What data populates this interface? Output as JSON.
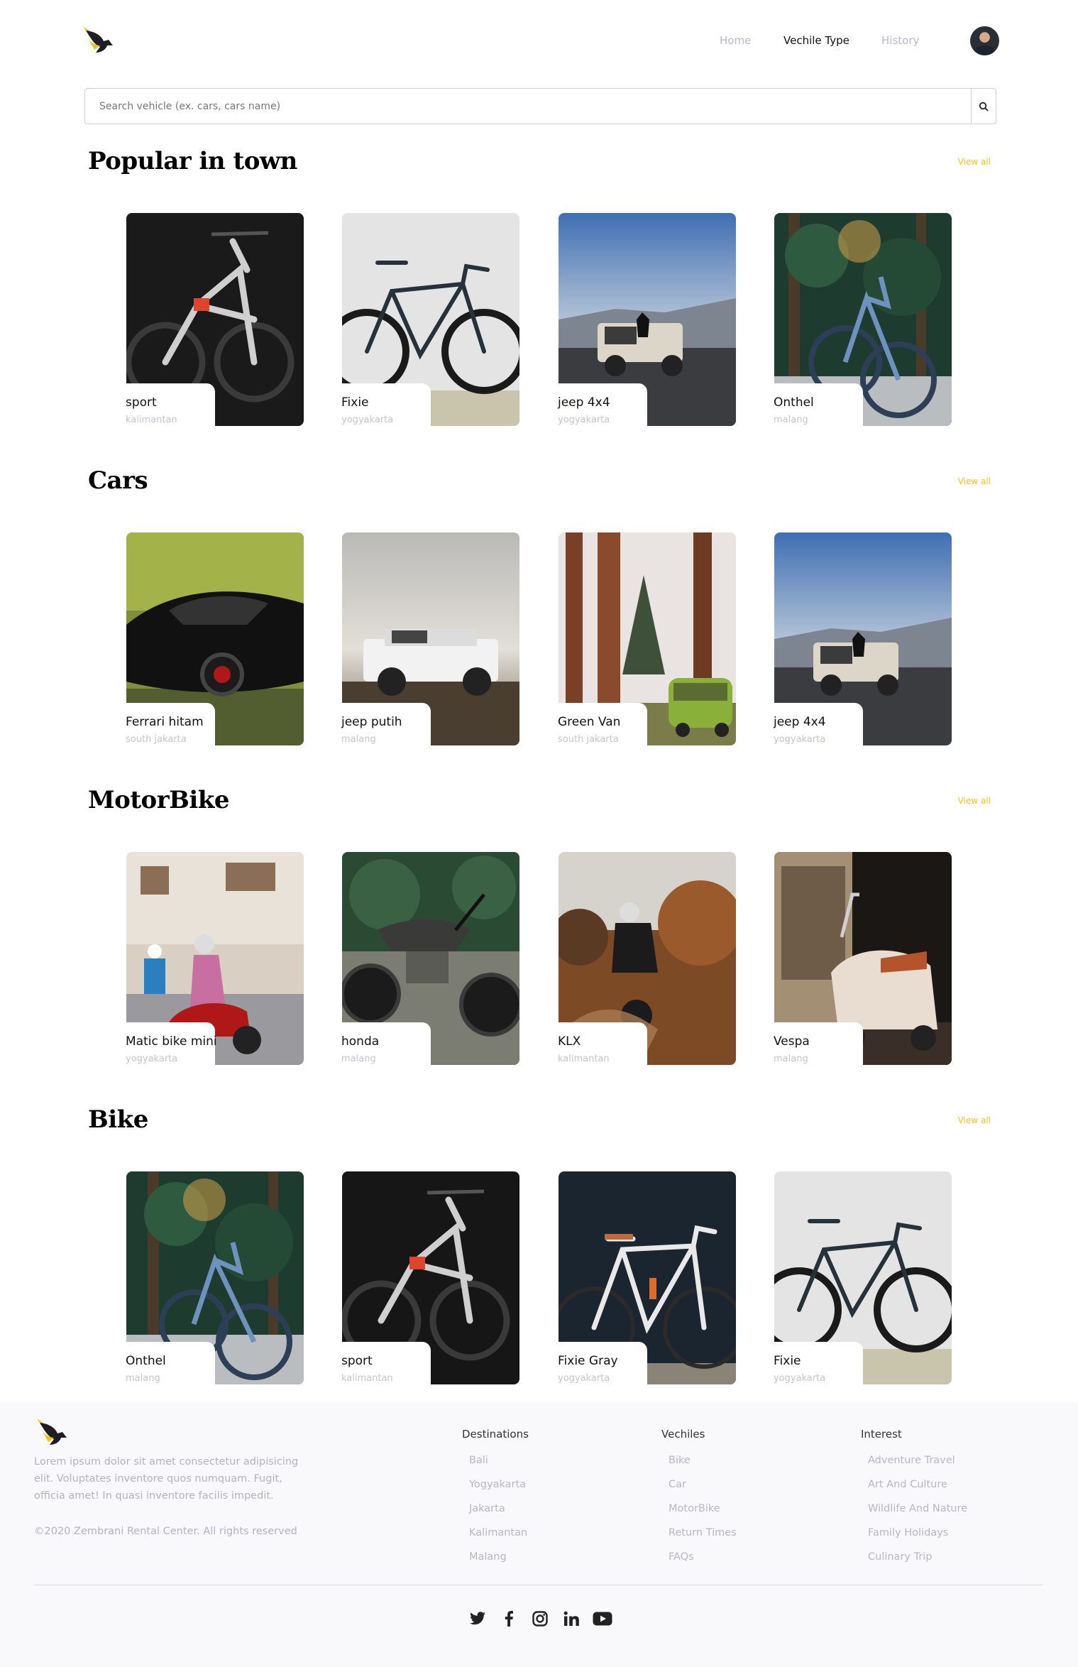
{
  "nav": {
    "items": [
      {
        "label": "Home"
      },
      {
        "label": "Vechile Type"
      },
      {
        "label": "History"
      }
    ]
  },
  "search": {
    "placeholder": "Search vehicle (ex. cars, cars name)"
  },
  "sections": [
    {
      "title": "Popular in town",
      "view_all": "View all",
      "cards": [
        {
          "name": "sport",
          "location": "kalimantan"
        },
        {
          "name": "Fixie",
          "location": "yogyakarta"
        },
        {
          "name": "jeep 4x4",
          "location": "yogyakarta"
        },
        {
          "name": "Onthel",
          "location": "malang"
        }
      ]
    },
    {
      "title": "Cars",
      "view_all": "View all",
      "cards": [
        {
          "name": "Ferrari hitam",
          "location": "south jakarta"
        },
        {
          "name": "jeep putih",
          "location": "malang"
        },
        {
          "name": "Green Van",
          "location": "south jakarta"
        },
        {
          "name": "jeep 4x4",
          "location": "yogyakarta"
        }
      ]
    },
    {
      "title": "MotorBike",
      "view_all": "View all",
      "cards": [
        {
          "name": "Matic bike mini",
          "location": "yogyakarta"
        },
        {
          "name": "honda",
          "location": "malang"
        },
        {
          "name": "KLX",
          "location": "kalimantan"
        },
        {
          "name": "Vespa",
          "location": "malang"
        }
      ]
    },
    {
      "title": "Bike",
      "view_all": "View all",
      "cards": [
        {
          "name": "Onthel",
          "location": "malang"
        },
        {
          "name": "sport",
          "location": "kalimantan"
        },
        {
          "name": "Fixie Gray",
          "location": "yogyakarta"
        },
        {
          "name": "Fixie",
          "location": "yogyakarta"
        }
      ]
    }
  ],
  "footer": {
    "about": "Lorem ipsum dolor sit amet consectetur adipisicing elit. Voluptates inventore quos numquam. Fugit, officia amet! In quasi inventore facilis impedit.",
    "copyright": "©2020 Zembrani Rental Center. All rights reserved",
    "columns": [
      {
        "title": "Destinations",
        "links": [
          "Bali",
          "Yogyakarta",
          "Jakarta",
          "Kalimantan",
          "Malang"
        ]
      },
      {
        "title": "Vechiles",
        "links": [
          "Bike",
          "Car",
          "MotorBike",
          "Return Times",
          "FAQs"
        ]
      },
      {
        "title": "Interest",
        "links": [
          "Adventure Travel",
          "Art And Culture",
          "Wildlife And Nature",
          "Family Holidays",
          "Culinary Trip"
        ]
      }
    ],
    "social": [
      "twitter-icon",
      "facebook-icon",
      "instagram-icon",
      "linkedin-icon",
      "youtube-icon"
    ]
  },
  "colors": {
    "accent": "#f5c016",
    "muted_text": "#b6b6c4",
    "footer_bg": "#f9f9fb"
  }
}
